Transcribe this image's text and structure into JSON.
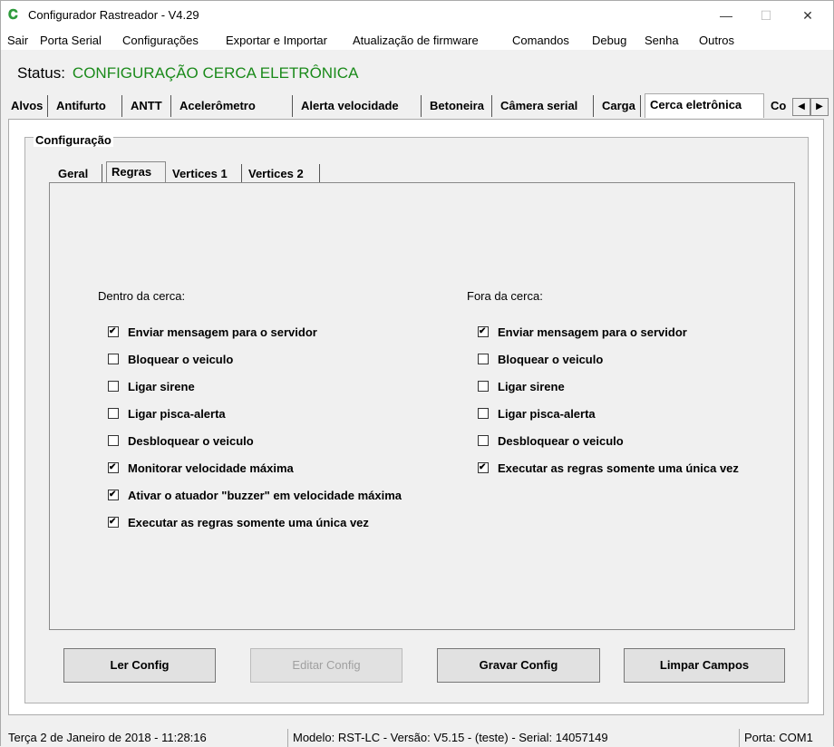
{
  "window": {
    "title": "Configurador Rastreador - V4.29",
    "minimize": "—",
    "maximize": "☐",
    "close": "✕"
  },
  "menu": [
    "Sair",
    "Porta Serial",
    "Configurações",
    "Exportar e Importar",
    "Atualização de firmware",
    "Comandos",
    "Debug",
    "Senha",
    "Outros"
  ],
  "status": {
    "label": "Status:",
    "value": "CONFIGURAÇÃO CERCA ELETRÔNICA"
  },
  "tabs": [
    "Alvos",
    "Antifurto",
    "ANTT",
    "Acelerômetro",
    "Alerta velocidade",
    "Betoneira",
    "Câmera serial",
    "Carga",
    "Cerca eletrônica",
    "Co"
  ],
  "group_title": "Configuração",
  "inner_tabs": [
    "Geral",
    "Regras",
    "Vertices 1",
    "Vertices 2"
  ],
  "dentro": {
    "title": "Dentro da cerca:",
    "items": [
      {
        "label": "Enviar mensagem para o servidor",
        "checked": true
      },
      {
        "label": "Bloquear o veiculo",
        "checked": false
      },
      {
        "label": "Ligar sirene",
        "checked": false
      },
      {
        "label": "Ligar pisca-alerta",
        "checked": false
      },
      {
        "label": "Desbloquear o veiculo",
        "checked": false
      },
      {
        "label": "Monitorar velocidade máxima",
        "checked": true
      },
      {
        "label": "Ativar o atuador \"buzzer\" em velocidade máxima",
        "checked": true
      },
      {
        "label": "Executar as regras somente uma única vez",
        "checked": true
      }
    ]
  },
  "fora": {
    "title": "Fora da cerca:",
    "items": [
      {
        "label": "Enviar mensagem para o servidor",
        "checked": true
      },
      {
        "label": "Bloquear o veiculo",
        "checked": false
      },
      {
        "label": "Ligar sirene",
        "checked": false
      },
      {
        "label": "Ligar pisca-alerta",
        "checked": false
      },
      {
        "label": "Desbloquear o veiculo",
        "checked": false
      },
      {
        "label": "Executar as regras somente uma única vez",
        "checked": true
      }
    ]
  },
  "buttons": {
    "ler": "Ler Config",
    "editar": "Editar Config",
    "gravar": "Gravar Config",
    "limpar": "Limpar Campos"
  },
  "statusbar": {
    "datetime": "Terça 2 de Janeiro de 2018  -  11:28:16",
    "model": "Modelo: RST-LC  -  Versão: V5.15 - (teste)  -  Serial: 14057149",
    "port": "Porta: COM1"
  }
}
